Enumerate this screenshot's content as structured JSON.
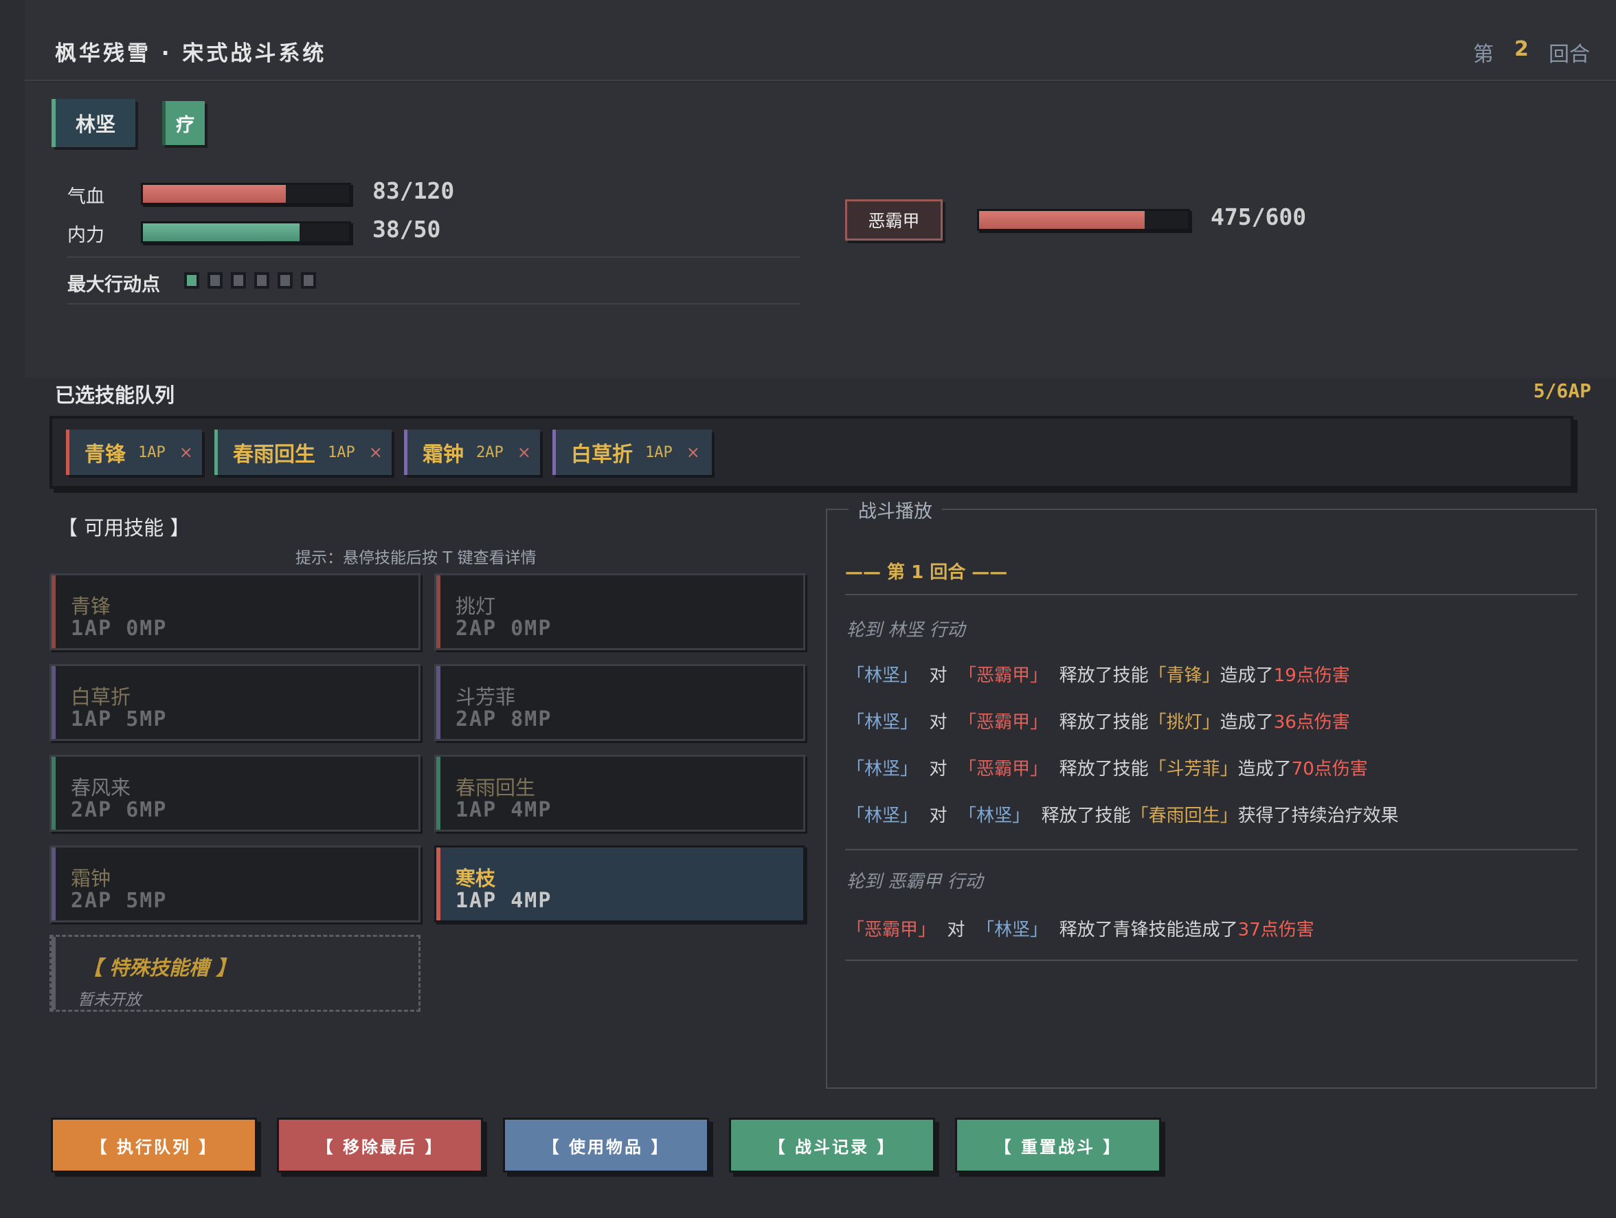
{
  "header": {
    "title": "枫华残雪 · 宋式战斗系统",
    "round_prefix": "第",
    "round_number": "2",
    "round_suffix": "回合"
  },
  "player": {
    "name": "林坚",
    "status_tag": "疗",
    "hp_label": "气血",
    "hp_value": "83/120",
    "hp_current": 83,
    "hp_max": 120,
    "mp_label": "内力",
    "mp_value": "38/50",
    "mp_current": 38,
    "mp_max": 50,
    "ap_label": "最大行动点",
    "ap_total": 6,
    "ap_filled": 1
  },
  "enemy": {
    "name": "恶霸甲",
    "hp_value": "475/600",
    "hp_current": 475,
    "hp_max": 600
  },
  "queue": {
    "title": "已选技能队列",
    "ap_used": "5/6AP",
    "items": [
      {
        "name": "青锋",
        "ap": "1AP",
        "remove": "×",
        "color": "#c85a50"
      },
      {
        "name": "春雨回生",
        "ap": "1AP",
        "remove": "×",
        "color": "#5aa486"
      },
      {
        "name": "霜钟",
        "ap": "2AP",
        "remove": "×",
        "color": "#7a6aa8"
      },
      {
        "name": "白草折",
        "ap": "1AP",
        "remove": "×",
        "color": "#7a6aa8"
      }
    ]
  },
  "skills": {
    "title": "【 可用技能 】",
    "hint": "提示：悬停技能后按 T 键查看详情",
    "items": [
      {
        "name": "青锋",
        "cost": "1AP 0MP",
        "color": "#8a4a44"
      },
      {
        "name": "挑灯",
        "cost": "2AP 0MP",
        "color": "#8a4a44"
      },
      {
        "name": "白草折",
        "cost": "1AP 5MP",
        "color": "#5e5480"
      },
      {
        "name": "斗芳菲",
        "cost": "2AP 8MP",
        "color": "#5e5480"
      },
      {
        "name": "春风来",
        "cost": "2AP 6MP",
        "color": "#3e7a62"
      },
      {
        "name": "春雨回生",
        "cost": "1AP 4MP",
        "color": "#3e7a62"
      },
      {
        "name": "霜钟",
        "cost": "2AP 5MP",
        "color": "#5e5480"
      },
      {
        "name": "寒枝",
        "cost": "1AP 4MP",
        "color": "#c85a50"
      }
    ],
    "special_title": "【 特殊技能槽 】",
    "special_sub": "暂未开放"
  },
  "log": {
    "title": "战斗播放",
    "round_header": "—— 第 1 回合 ——",
    "turn1": "轮到 林坚 行动",
    "turn2": "轮到 恶霸甲 行动",
    "lines": [
      {
        "actor": "「林坚」",
        "to": "对",
        "target": "「恶霸甲」",
        "verb": "释放了技能",
        "skill": "「青锋」",
        "result": "造成了",
        "dmg": "19点伤害"
      },
      {
        "actor": "「林坚」",
        "to": "对",
        "target": "「恶霸甲」",
        "verb": "释放了技能",
        "skill": "「挑灯」",
        "result": "造成了",
        "dmg": "36点伤害"
      },
      {
        "actor": "「林坚」",
        "to": "对",
        "target": "「恶霸甲」",
        "verb": "释放了技能",
        "skill": "「斗芳菲」",
        "result": "造成了",
        "dmg": "70点伤害"
      },
      {
        "actor": "「林坚」",
        "to": "对",
        "target": "「林坚」",
        "verb": "释放了技能",
        "skill": "「春雨回生」",
        "result": "获得了持续治疗效果",
        "dmg": ""
      }
    ],
    "enemy_line": {
      "actor": "「恶霸甲」",
      "to": "对",
      "target": "「林坚」",
      "verb": "释放了青锋技能造成了",
      "dmg": "37点伤害"
    }
  },
  "buttons": [
    {
      "label": "【 执行队列 】",
      "color": "#d9843a"
    },
    {
      "label": "【 移除最后 】",
      "color": "#b85555"
    },
    {
      "label": "【 使用物品 】",
      "color": "#5f7ea6"
    },
    {
      "label": "【 战斗记录 】",
      "color": "#4e9a78"
    },
    {
      "label": "【 重置战斗 】",
      "color": "#4e9a78"
    }
  ]
}
